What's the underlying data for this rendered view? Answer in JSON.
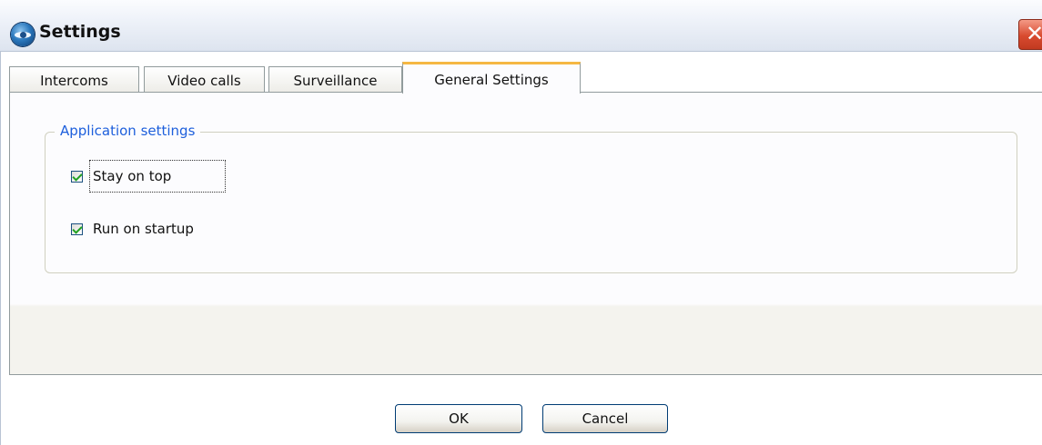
{
  "window": {
    "title": "Settings",
    "app_icon": "app-eye-icon",
    "close_icon": "close-icon"
  },
  "tabs": [
    {
      "label": "Intercoms",
      "active": false
    },
    {
      "label": "Video calls",
      "active": false
    },
    {
      "label": "Surveillance",
      "active": false
    },
    {
      "label": "General Settings",
      "active": true
    }
  ],
  "group": {
    "title": "Application settings",
    "options": [
      {
        "label": "Stay on top",
        "checked": true,
        "focused": true
      },
      {
        "label": "Run on startup",
        "checked": true,
        "focused": false
      }
    ]
  },
  "buttons": {
    "ok_label": "OK",
    "cancel_label": "Cancel"
  },
  "colors": {
    "tab_highlight": "#f5b743",
    "group_title": "#1d5fdc",
    "checkmark": "#21a121",
    "close_button": "#d84a2f"
  }
}
